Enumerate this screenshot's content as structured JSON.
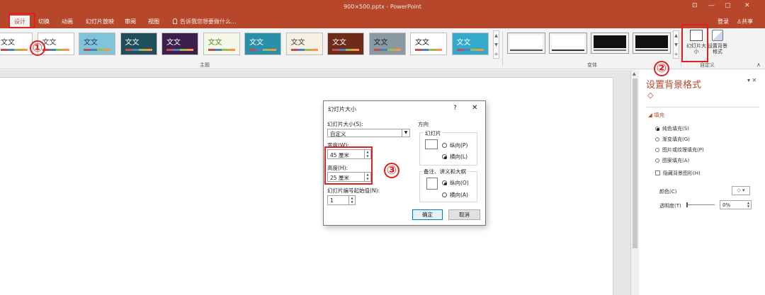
{
  "window": {
    "title": "900×500.pptx - PowerPoint",
    "controls": [
      "⊡",
      "—",
      "▢",
      "✕"
    ]
  },
  "tabs": [
    {
      "label": "设计"
    },
    {
      "label": "切换"
    },
    {
      "label": "动画"
    },
    {
      "label": "幻灯片放映"
    },
    {
      "label": "审阅"
    },
    {
      "label": "视图"
    }
  ],
  "tell_me": "告诉我您想要做什么...",
  "account": {
    "login": "登录",
    "share": "共享"
  },
  "ribbon": {
    "themes_group_label": "主题",
    "variants_group_label": "变体",
    "customize_group_label": "自定义",
    "themes": [
      {
        "text": "文文",
        "bg": "#ffffff",
        "fg": "#333333"
      },
      {
        "text": "文文",
        "bg": "#ffffff",
        "fg": "#444444"
      },
      {
        "text": "文文",
        "bg": "#7fc4d8",
        "fg": "#1e3a50"
      },
      {
        "text": "文文",
        "bg": "#1e4f5a",
        "fg": "#ffffff"
      },
      {
        "text": "文文",
        "bg": "#3d1f4d",
        "fg": "#ffffff"
      },
      {
        "text": "文文",
        "bg": "#f3f8e8",
        "fg": "#5a8f1e"
      },
      {
        "text": "文文",
        "bg": "#2a8fa8",
        "fg": "#ffffff"
      },
      {
        "text": "文文",
        "bg": "#f6f1e4",
        "fg": "#444444"
      },
      {
        "text": "文文",
        "bg": "#6e2b1a",
        "fg": "#ffffff"
      },
      {
        "text": "文文",
        "bg": "#8a9aa3",
        "fg": "#222222"
      },
      {
        "text": "文文",
        "bg": "#ffffff",
        "fg": "#222222"
      },
      {
        "text": "文文",
        "bg": "#33aacc",
        "fg": "#ffffff"
      }
    ],
    "variants": [
      {
        "bg": "#ffffff",
        "line": "#555555"
      },
      {
        "bg": "#ffffff",
        "line": "#333333"
      },
      {
        "bg": "#111111",
        "line": "#777777"
      },
      {
        "bg": "#111111",
        "line": "#555555"
      }
    ],
    "slide_size_label": "幻灯片大小",
    "bg_format_label": "设置背景格式"
  },
  "annotations": [
    "①",
    "②",
    "③"
  ],
  "dialog": {
    "title": "幻灯片大小",
    "help": "?",
    "close": "✕",
    "size_label": "幻灯片大小(S):",
    "size_value": "自定义",
    "width_label": "宽度(W):",
    "width_value": "45 厘米",
    "height_label": "高度(H):",
    "height_value": "25 厘米",
    "start_label": "幻灯片编号起始值(N):",
    "start_value": "1",
    "orientation_label": "方向",
    "slides_group_label": "幻灯片",
    "notes_group_label": "备注、讲义和大纲",
    "slides_portrait": "纵向(P)",
    "slides_landscape": "横向(L)",
    "notes_portrait": "纵向(O)",
    "notes_landscape": "横向(A)",
    "ok": "确定",
    "cancel": "取消"
  },
  "pane": {
    "title": "设置背景格式",
    "close": "▾ ✕",
    "fill_section": "◢ 填充",
    "fill_options": [
      {
        "label": "纯色填充(S)",
        "selected": true
      },
      {
        "label": "渐变填充(G)",
        "selected": false
      },
      {
        "label": "图片或纹理填充(P)",
        "selected": false
      },
      {
        "label": "图案填充(A)",
        "selected": false
      }
    ],
    "hide_bg": "隐藏背景图形(H)",
    "color_label": "颜色(C)",
    "transparency_label": "透明度(T)",
    "transparency_value": "0%"
  }
}
